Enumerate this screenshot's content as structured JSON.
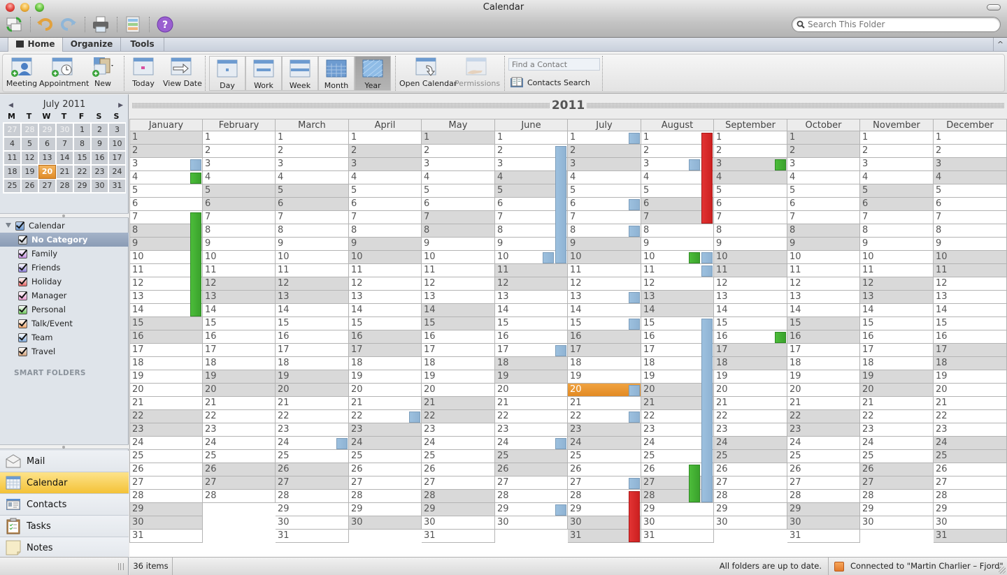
{
  "window": {
    "title": "Calendar"
  },
  "toolbar": {
    "icons": [
      "send-receive-icon",
      "undo-icon",
      "redo-icon",
      "print-icon",
      "categories-icon",
      "help-icon"
    ],
    "search_placeholder": "Search This Folder"
  },
  "ribbon_tabs": [
    {
      "label": "Home",
      "active": true
    },
    {
      "label": "Organize",
      "active": false
    },
    {
      "label": "Tools",
      "active": false
    }
  ],
  "ribbon": {
    "new_group": [
      "Meeting",
      "Appointment",
      "New"
    ],
    "goto_group": [
      "Today",
      "View Date"
    ],
    "view_group": [
      {
        "label": "Day",
        "selected": false
      },
      {
        "label": "Work",
        "selected": false
      },
      {
        "label": "Week",
        "selected": false
      },
      {
        "label": "Month",
        "selected": false
      },
      {
        "label": "Year",
        "selected": true
      }
    ],
    "share_group": [
      {
        "label": "Open Calendar",
        "disabled": false
      },
      {
        "label": "Permissions",
        "disabled": true
      }
    ],
    "find_contact_placeholder": "Find a Contact",
    "contacts_search": "Contacts Search"
  },
  "mini_calendar": {
    "title": "July 2011",
    "weekdays": [
      "M",
      "T",
      "W",
      "T",
      "F",
      "S",
      "S"
    ],
    "days": [
      {
        "d": "27",
        "other": true
      },
      {
        "d": "28",
        "other": true
      },
      {
        "d": "29",
        "other": true
      },
      {
        "d": "30",
        "other": true
      },
      {
        "d": "1"
      },
      {
        "d": "2"
      },
      {
        "d": "3"
      },
      {
        "d": "4"
      },
      {
        "d": "5"
      },
      {
        "d": "6"
      },
      {
        "d": "7"
      },
      {
        "d": "8"
      },
      {
        "d": "9"
      },
      {
        "d": "10"
      },
      {
        "d": "11"
      },
      {
        "d": "12"
      },
      {
        "d": "13"
      },
      {
        "d": "14"
      },
      {
        "d": "15"
      },
      {
        "d": "16"
      },
      {
        "d": "17"
      },
      {
        "d": "18"
      },
      {
        "d": "19"
      },
      {
        "d": "20",
        "today": true
      },
      {
        "d": "21"
      },
      {
        "d": "22"
      },
      {
        "d": "23"
      },
      {
        "d": "24"
      },
      {
        "d": "25"
      },
      {
        "d": "26"
      },
      {
        "d": "27"
      },
      {
        "d": "28"
      },
      {
        "d": "29"
      },
      {
        "d": "30"
      },
      {
        "d": "31"
      }
    ]
  },
  "calendar_tree": {
    "root": "Calendar",
    "categories": [
      {
        "label": "No Category",
        "color": "#c8ccd4",
        "selected": true
      },
      {
        "label": "Family",
        "color": "#c58be0"
      },
      {
        "label": "Friends",
        "color": "#8d7fd8"
      },
      {
        "label": "Holiday",
        "color": "#e56464"
      },
      {
        "label": "Manager",
        "color": "#e99ad0"
      },
      {
        "label": "Personal",
        "color": "#6cc65a"
      },
      {
        "label": "Talk/Event",
        "color": "#f0a56a"
      },
      {
        "label": "Team",
        "color": "#7fa9db"
      },
      {
        "label": "Travel",
        "color": "#d3a27a"
      }
    ],
    "smart_folders": "SMART FOLDERS"
  },
  "nav": [
    {
      "label": "Mail",
      "icon": "mail-icon"
    },
    {
      "label": "Calendar",
      "icon": "calendar-icon",
      "selected": true
    },
    {
      "label": "Contacts",
      "icon": "contacts-icon"
    },
    {
      "label": "Tasks",
      "icon": "tasks-icon"
    },
    {
      "label": "Notes",
      "icon": "notes-icon"
    }
  ],
  "year_view": {
    "year": "2011",
    "today": {
      "month": 7,
      "day": 20
    },
    "months": [
      {
        "name": "January",
        "days": 31
      },
      {
        "name": "February",
        "days": 28
      },
      {
        "name": "March",
        "days": 31
      },
      {
        "name": "April",
        "days": 30
      },
      {
        "name": "May",
        "days": 31
      },
      {
        "name": "June",
        "days": 30
      },
      {
        "name": "July",
        "days": 31
      },
      {
        "name": "August",
        "days": 31
      },
      {
        "name": "September",
        "days": 30
      },
      {
        "name": "October",
        "days": 31
      },
      {
        "name": "November",
        "days": 30
      },
      {
        "name": "December",
        "days": 31
      }
    ],
    "events": [
      {
        "month": 1,
        "start": 3,
        "end": 3,
        "color": "blue",
        "lane": 0
      },
      {
        "month": 1,
        "start": 4,
        "end": 4,
        "color": "green",
        "lane": 0
      },
      {
        "month": 1,
        "start": 7,
        "end": 14,
        "color": "green",
        "lane": 0
      },
      {
        "month": 3,
        "start": 24,
        "end": 24,
        "color": "blue",
        "lane": 0
      },
      {
        "month": 4,
        "start": 22,
        "end": 22,
        "color": "blue",
        "lane": 0
      },
      {
        "month": 6,
        "start": 2,
        "end": 10,
        "color": "blue",
        "lane": 0
      },
      {
        "month": 6,
        "start": 10,
        "end": 10,
        "color": "blue",
        "lane": 1
      },
      {
        "month": 6,
        "start": 17,
        "end": 17,
        "color": "blue",
        "lane": 0
      },
      {
        "month": 6,
        "start": 24,
        "end": 24,
        "color": "blue",
        "lane": 0
      },
      {
        "month": 6,
        "start": 29,
        "end": 29,
        "color": "blue",
        "lane": 0
      },
      {
        "month": 7,
        "start": 1,
        "end": 1,
        "color": "blue",
        "lane": 0
      },
      {
        "month": 7,
        "start": 6,
        "end": 6,
        "color": "blue",
        "lane": 0
      },
      {
        "month": 7,
        "start": 8,
        "end": 8,
        "color": "blue",
        "lane": 0
      },
      {
        "month": 7,
        "start": 13,
        "end": 13,
        "color": "blue",
        "lane": 0
      },
      {
        "month": 7,
        "start": 15,
        "end": 15,
        "color": "blue",
        "lane": 0
      },
      {
        "month": 7,
        "start": 20,
        "end": 20,
        "color": "blue",
        "lane": 0
      },
      {
        "month": 7,
        "start": 22,
        "end": 22,
        "color": "blue",
        "lane": 0
      },
      {
        "month": 7,
        "start": 27,
        "end": 27,
        "color": "blue",
        "lane": 0
      },
      {
        "month": 7,
        "start": 28,
        "end": 31,
        "color": "red",
        "lane": 0
      },
      {
        "month": 8,
        "start": 1,
        "end": 7,
        "color": "red",
        "lane": 0
      },
      {
        "month": 8,
        "start": 3,
        "end": 3,
        "color": "blue",
        "lane": 1
      },
      {
        "month": 8,
        "start": 10,
        "end": 10,
        "color": "blue",
        "lane": 0
      },
      {
        "month": 8,
        "start": 10,
        "end": 10,
        "color": "green",
        "lane": 1
      },
      {
        "month": 8,
        "start": 11,
        "end": 11,
        "color": "blue",
        "lane": 0
      },
      {
        "month": 8,
        "start": 15,
        "end": 28,
        "color": "blue",
        "lane": 0
      },
      {
        "month": 8,
        "start": 26,
        "end": 28,
        "color": "green",
        "lane": 1
      },
      {
        "month": 9,
        "start": 3,
        "end": 3,
        "color": "green",
        "lane": 0
      },
      {
        "month": 9,
        "start": 16,
        "end": 16,
        "color": "green",
        "lane": 0
      }
    ]
  },
  "status": {
    "items": "36 items",
    "sync": "All folders are up to date.",
    "connection": "Connected to \"Martin Charlier – Fjord\""
  }
}
